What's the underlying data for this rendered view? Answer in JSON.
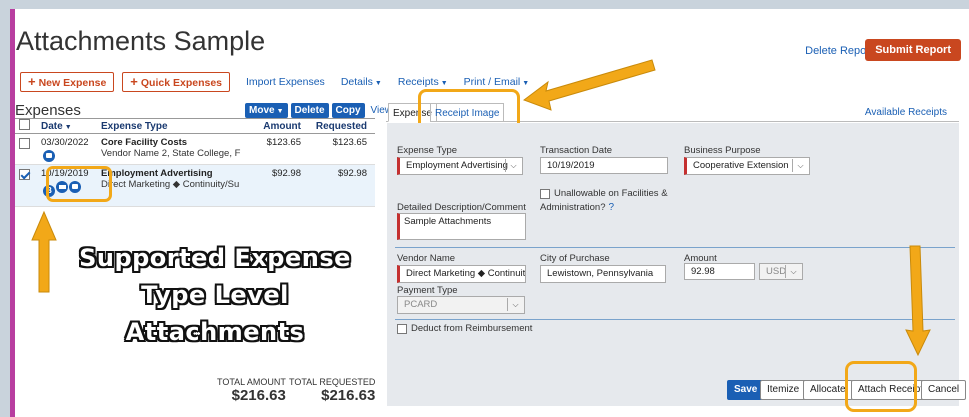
{
  "page": {
    "title": "Attachments Sample",
    "delete_report": "Delete Report",
    "submit_report": "Submit Report"
  },
  "toolbar": {
    "new_expense": "New Expense",
    "quick_expenses": "Quick Expenses",
    "import_expenses": "Import Expenses",
    "details": "Details",
    "receipts": "Receipts",
    "print_email": "Print / Email"
  },
  "expenses": {
    "title": "Expenses",
    "move": "Move",
    "delete": "Delete",
    "copy": "Copy",
    "view": "View",
    "columns": {
      "date": "Date",
      "type": "Expense Type",
      "amount": "Amount",
      "requested": "Requested"
    },
    "rows": [
      {
        "date": "03/30/2022",
        "type": "Core Facility Costs",
        "vendor": "Vendor Name 2, State College, F",
        "amount": "$123.65",
        "requested": "$123.65",
        "checked": false
      },
      {
        "date": "10/19/2019",
        "type": "Employment Advertising",
        "vendor": "Direct Marketing ◆ Continuity/Su",
        "amount": "$92.98",
        "requested": "$92.98",
        "checked": true
      }
    ],
    "total_amount_label": "TOTAL AMOUNT",
    "total_amount": "$216.63",
    "total_requested_label": "TOTAL REQUESTED",
    "total_requested": "$216.63"
  },
  "tabs": {
    "expense": "Expense",
    "receipt_image": "Receipt Image",
    "available_receipts": "Available Receipts"
  },
  "form": {
    "expense_type_label": "Expense Type",
    "expense_type": "Employment Advertising",
    "transaction_date_label": "Transaction Date",
    "transaction_date": "10/19/2019",
    "business_purpose_label": "Business Purpose",
    "business_purpose": "Cooperative Extension",
    "unallowable_label_1": "Unallowable on Facilities &",
    "unallowable_label_2": "Administration?",
    "description_label": "Detailed Description/Comment",
    "description": "Sample Attachments",
    "vendor_label": "Vendor Name",
    "vendor": "Direct Marketing ◆ Continuity/Su",
    "city_label": "City of Purchase",
    "city": "Lewistown, Pennsylvania",
    "amount_label": "Amount",
    "amount": "92.98",
    "currency": "USD",
    "payment_type_label": "Payment Type",
    "payment_type": "PCARD",
    "deduct_label": "Deduct from Reimbursement"
  },
  "actions": {
    "save": "Save",
    "itemize": "Itemize",
    "allocate": "Allocate",
    "attach_receipt": "Attach Receipt",
    "cancel": "Cancel"
  },
  "annotation": {
    "line1": "Supported Expense",
    "line2": "Type Level",
    "line3": "Attachments"
  },
  "colors": {
    "highlight": "#f2a818",
    "brand": "#c9471f",
    "link": "#1a5fb4"
  }
}
